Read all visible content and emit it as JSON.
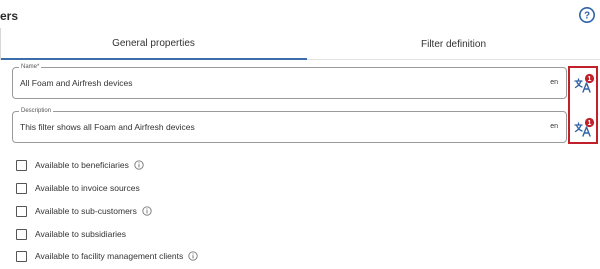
{
  "header": {
    "title_fragment": "ers",
    "help_icon": "help-circle-icon"
  },
  "tabs": [
    {
      "label": "General properties",
      "active": true
    },
    {
      "label": "Filter definition",
      "active": false
    }
  ],
  "fields": {
    "name": {
      "label": "Name*",
      "value": "All Foam and Airfresh devices",
      "lang": "en"
    },
    "description": {
      "label": "Description",
      "value": "This filter shows all Foam and Airfresh devices",
      "lang": "en"
    }
  },
  "translate_buttons": {
    "icon": "translate-icon",
    "badge_count": "1",
    "badge_color": "#c0202a"
  },
  "highlight_color": "#c0202a",
  "accent_color": "#3b6ea8",
  "checkboxes": [
    {
      "label": "Available to beneficiaries",
      "checked": false,
      "info": true
    },
    {
      "label": "Available to invoice sources",
      "checked": false,
      "info": false
    },
    {
      "label": "Available to sub-customers",
      "checked": false,
      "info": true
    },
    {
      "label": "Available to subsidiaries",
      "checked": false,
      "info": false
    },
    {
      "label": "Available to facility management clients",
      "checked": false,
      "info": true
    }
  ]
}
